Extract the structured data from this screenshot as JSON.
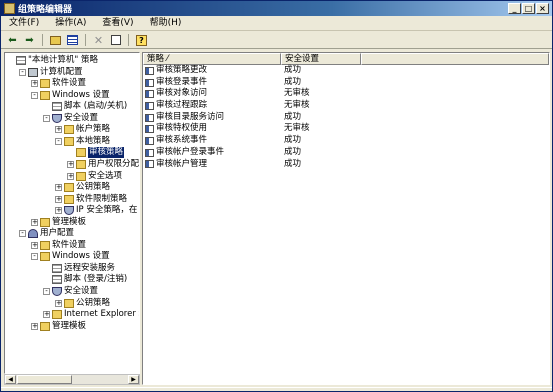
{
  "window": {
    "title": "组策略编辑器"
  },
  "menubar": {
    "items": [
      "文件(F)",
      "操作(A)",
      "查看(V)",
      "帮助(H)"
    ]
  },
  "tree": [
    {
      "label": "\"本地计算机\" 策略",
      "level": 0,
      "icon": "policy-icon",
      "expander": ""
    },
    {
      "label": "计算机配置",
      "level": 1,
      "icon": "computer-icon",
      "expander": "-"
    },
    {
      "label": "软件设置",
      "level": 2,
      "icon": "folder-icon",
      "expander": "+"
    },
    {
      "label": "Windows 设置",
      "level": 2,
      "icon": "folder-icon",
      "expander": "-"
    },
    {
      "label": "脚本 (启动/关机)",
      "level": 3,
      "icon": "policy-icon",
      "expander": ""
    },
    {
      "label": "安全设置",
      "level": 3,
      "icon": "shield-icon",
      "expander": "-"
    },
    {
      "label": "帐户策略",
      "level": 4,
      "icon": "folder-icon",
      "expander": "+"
    },
    {
      "label": "本地策略",
      "level": 4,
      "icon": "folder-icon",
      "expander": "-"
    },
    {
      "label": "审核策略",
      "level": 5,
      "icon": "folder-icon",
      "expander": "",
      "selected": true
    },
    {
      "label": "用户权限分配",
      "level": 5,
      "icon": "folder-icon",
      "expander": "+"
    },
    {
      "label": "安全选项",
      "level": 5,
      "icon": "folder-icon",
      "expander": "+"
    },
    {
      "label": "公钥策略",
      "level": 4,
      "icon": "folder-icon",
      "expander": "+"
    },
    {
      "label": "软件限制策略",
      "level": 4,
      "icon": "folder-icon",
      "expander": "+"
    },
    {
      "label": "IP 安全策略，在",
      "level": 4,
      "icon": "shield-icon",
      "expander": "+"
    },
    {
      "label": "管理模板",
      "level": 2,
      "icon": "folder-icon",
      "expander": "+"
    },
    {
      "label": "用户配置",
      "level": 1,
      "icon": "user-icon",
      "expander": "-"
    },
    {
      "label": "软件设置",
      "level": 2,
      "icon": "folder-icon",
      "expander": "+"
    },
    {
      "label": "Windows 设置",
      "level": 2,
      "icon": "folder-icon",
      "expander": "-"
    },
    {
      "label": "远程安装服务",
      "level": 3,
      "icon": "policy-icon",
      "expander": ""
    },
    {
      "label": "脚本 (登录/注销)",
      "level": 3,
      "icon": "policy-icon",
      "expander": ""
    },
    {
      "label": "安全设置",
      "level": 3,
      "icon": "shield-icon",
      "expander": "-"
    },
    {
      "label": "公钥策略",
      "level": 4,
      "icon": "folder-icon",
      "expander": "+"
    },
    {
      "label": "Internet Explorer 维",
      "level": 3,
      "icon": "folder-icon",
      "expander": "+"
    },
    {
      "label": "管理模板",
      "level": 2,
      "icon": "folder-icon",
      "expander": "+"
    }
  ],
  "list": {
    "columns": [
      "策略 ⁄",
      "安全设置"
    ],
    "rows": [
      {
        "policy": "审核策略更改",
        "setting": "成功"
      },
      {
        "policy": "审核登录事件",
        "setting": "成功"
      },
      {
        "policy": "审核对象访问",
        "setting": "无审核"
      },
      {
        "policy": "审核过程跟踪",
        "setting": "无审核"
      },
      {
        "policy": "审核目录服务访问",
        "setting": "成功"
      },
      {
        "policy": "审核特权使用",
        "setting": "无审核"
      },
      {
        "policy": "审核系统事件",
        "setting": "成功"
      },
      {
        "policy": "审核帐户登录事件",
        "setting": "成功"
      },
      {
        "policy": "审核帐户管理",
        "setting": "成功"
      }
    ]
  }
}
